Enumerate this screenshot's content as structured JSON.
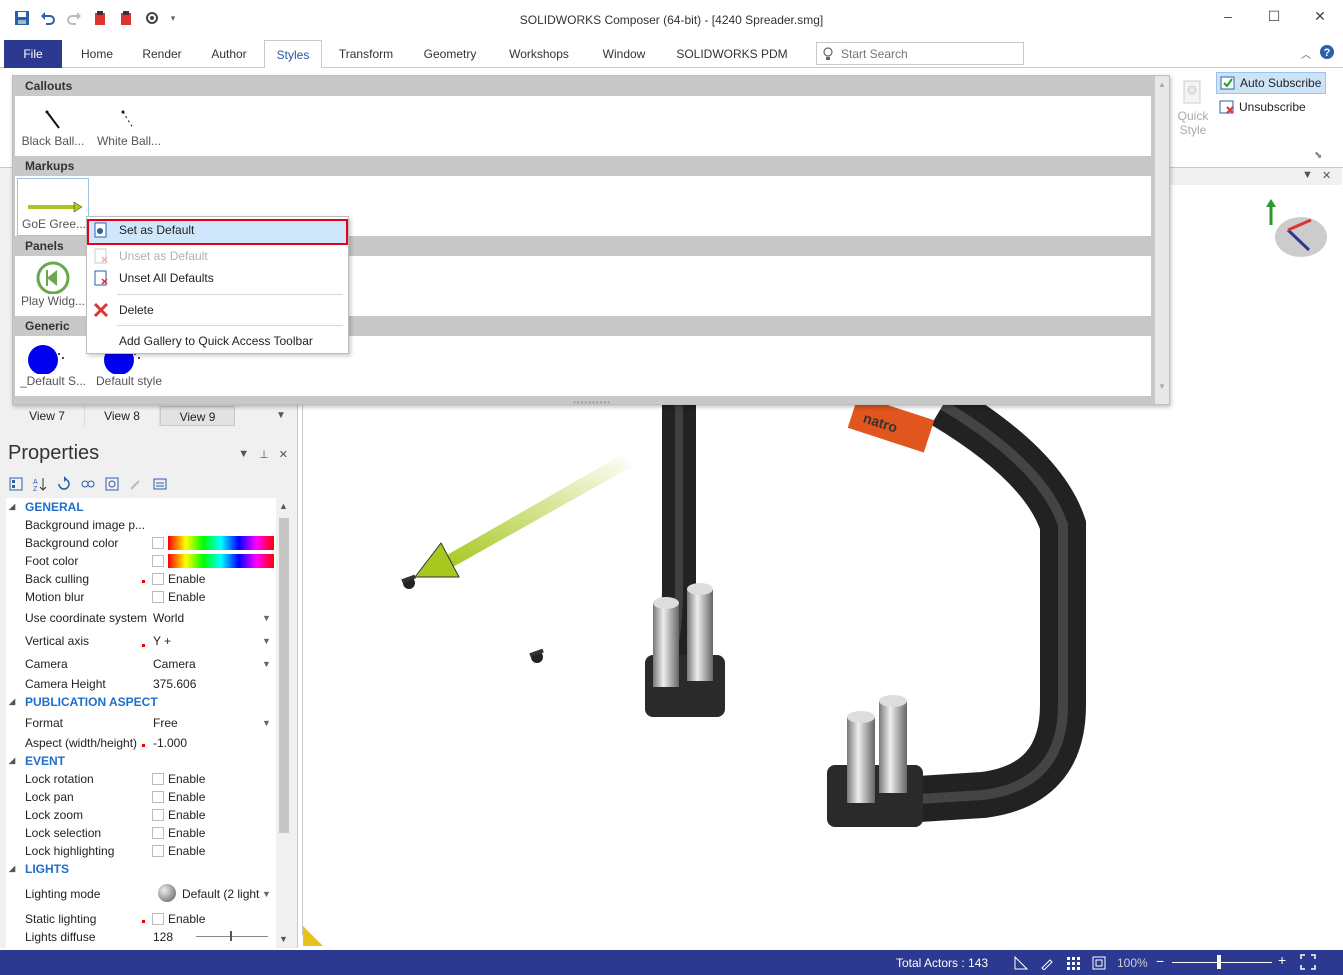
{
  "window": {
    "title": "SOLIDWORKS Composer (64-bit) - [4240 Spreader.smg]"
  },
  "ribbon": {
    "tabs": [
      {
        "label": "File"
      },
      {
        "label": "Home"
      },
      {
        "label": "Render"
      },
      {
        "label": "Author"
      },
      {
        "label": "Styles"
      },
      {
        "label": "Transform"
      },
      {
        "label": "Geometry"
      },
      {
        "label": "Workshops"
      },
      {
        "label": "Window"
      },
      {
        "label": "SOLIDWORKS PDM"
      }
    ],
    "active_tab": "Styles",
    "search_placeholder": "Start Search",
    "quick_style_label": "Quick Style",
    "quick_style_line1": "Quick",
    "quick_style_line2": "Style",
    "auto_subscribe": "Auto Subscribe",
    "unsubscribe": "Unsubscribe"
  },
  "gallery": {
    "sections": [
      {
        "title": "Callouts",
        "items": [
          {
            "label": "Black Ball..."
          },
          {
            "label": "White Ball..."
          }
        ]
      },
      {
        "title": "Markups",
        "items": [
          {
            "label": "GoE Gree..."
          }
        ]
      },
      {
        "title": "Panels",
        "items": [
          {
            "label": "Play Widg..."
          }
        ]
      },
      {
        "title": "Generic",
        "items": [
          {
            "label": "_Default S..."
          },
          {
            "label": "Default style"
          }
        ]
      }
    ]
  },
  "context_menu": {
    "items": [
      {
        "label": "Set as Default",
        "highlighted": true,
        "enabled": true
      },
      {
        "label": "Unset as Default",
        "enabled": false
      },
      {
        "label": "Unset All Defaults",
        "enabled": true
      },
      {
        "label": "Delete",
        "enabled": true
      },
      {
        "label": "Add Gallery to Quick Access Toolbar",
        "enabled": true
      }
    ]
  },
  "views": {
    "tabs": [
      {
        "label": "View 7"
      },
      {
        "label": "View 8"
      },
      {
        "label": "View 9"
      }
    ],
    "selected": "View 9"
  },
  "properties": {
    "title": "Properties",
    "sections": {
      "general": "GENERAL",
      "publication": "PUBLICATION ASPECT",
      "event": "EVENT",
      "lights": "LIGHTS"
    },
    "general": {
      "background_image": "Background image p...",
      "background_color": "Background color",
      "foot_color": "Foot color",
      "back_culling": "Back culling",
      "motion_blur": "Motion blur",
      "coordinate_system": "Use coordinate system",
      "coordinate_system_value": "World",
      "vertical_axis": "Vertical axis",
      "vertical_axis_value": "Y +",
      "camera": "Camera",
      "camera_value": "Camera",
      "camera_height": "Camera Height",
      "camera_height_value": "375.606"
    },
    "publication": {
      "format": "Format",
      "format_value": "Free",
      "aspect": "Aspect (width/height)",
      "aspect_value": "-1.000"
    },
    "event": {
      "lock_rotation": "Lock rotation",
      "lock_pan": "Lock pan",
      "lock_zoom": "Lock zoom",
      "lock_selection": "Lock selection",
      "lock_highlighting": "Lock highlighting"
    },
    "lights": {
      "lighting_mode": "Lighting mode",
      "lighting_mode_value": "Default (2 light",
      "static_lighting": "Static lighting",
      "lights_diffuse": "Lights diffuse",
      "lights_diffuse_value": "128"
    },
    "enable_label": "Enable"
  },
  "viewport": {
    "brand_text": "natro"
  },
  "status": {
    "total_actors": "Total Actors : 143",
    "zoom": "100%"
  },
  "colors": {
    "accent": "#2b3990",
    "highlight_border": "#e3001b",
    "section_blue": "#1e6fc8",
    "arrow_green": "#a8c820"
  }
}
